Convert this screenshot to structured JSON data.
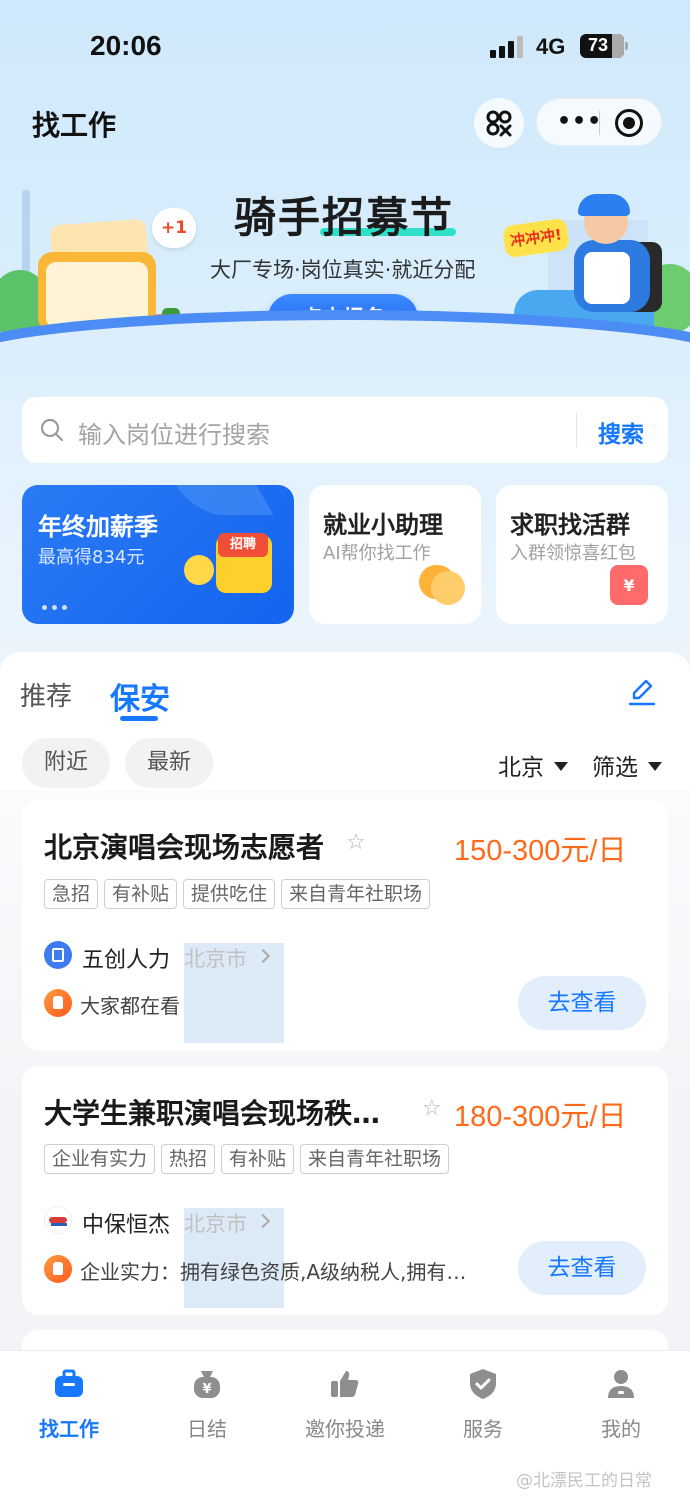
{
  "status_bar": {
    "time": "20:06",
    "network": "4G",
    "battery": "73"
  },
  "header": {
    "title": "找工作"
  },
  "banner": {
    "title": "骑手招募节",
    "subtitle": "大厂专场·岗位真实·就近分配",
    "button_label": "点击报名",
    "plus_badge": "+1",
    "sticker": "冲冲冲!"
  },
  "search": {
    "placeholder": "输入岗位进行搜索",
    "button_label": "搜索"
  },
  "features": [
    {
      "title": "年终加薪季",
      "subtitle": "最高得834元",
      "badge": "招聘"
    },
    {
      "title": "就业小助理",
      "subtitle": "AI帮你找工作"
    },
    {
      "title": "求职找活群",
      "subtitle": "入群领惊喜红包",
      "icon_text": "¥"
    }
  ],
  "tabs": [
    {
      "label": "推荐",
      "active": false
    },
    {
      "label": "保安",
      "active": true
    }
  ],
  "chips": [
    "附近",
    "最新"
  ],
  "filters": {
    "city": "北京",
    "screen": "筛选"
  },
  "jobs": [
    {
      "title": "北京演唱会现场志愿者",
      "salary": "150-300元/日",
      "tags": [
        "急招",
        "有补贴",
        "提供吃住",
        "来自青年社职场"
      ],
      "company": "五创人力",
      "city": "北京市",
      "note": "大家都在看",
      "button": "去查看"
    },
    {
      "title": "大学生兼职演唱会现场秩…",
      "salary": "180-300元/日",
      "tags": [
        "企业有实力",
        "热招",
        "有补贴",
        "来自青年社职场"
      ],
      "company": "中保恒杰",
      "city": "北京市",
      "note": "企业实力：拥有绿色资质,A级纳税人,拥有…",
      "button": "去查看"
    }
  ],
  "bottom_nav": [
    {
      "label": "找工作",
      "icon": "briefcase-icon",
      "active": true
    },
    {
      "label": "日结",
      "icon": "money-bag-icon",
      "active": false
    },
    {
      "label": "邀你投递",
      "icon": "thumbs-up-icon",
      "active": false
    },
    {
      "label": "服务",
      "icon": "shield-icon",
      "active": false
    },
    {
      "label": "我的",
      "icon": "user-icon",
      "active": false
    }
  ],
  "watermark": "@北漂民工的日常",
  "colors": {
    "accent": "#1677ff",
    "salary": "#ff6a1a"
  }
}
